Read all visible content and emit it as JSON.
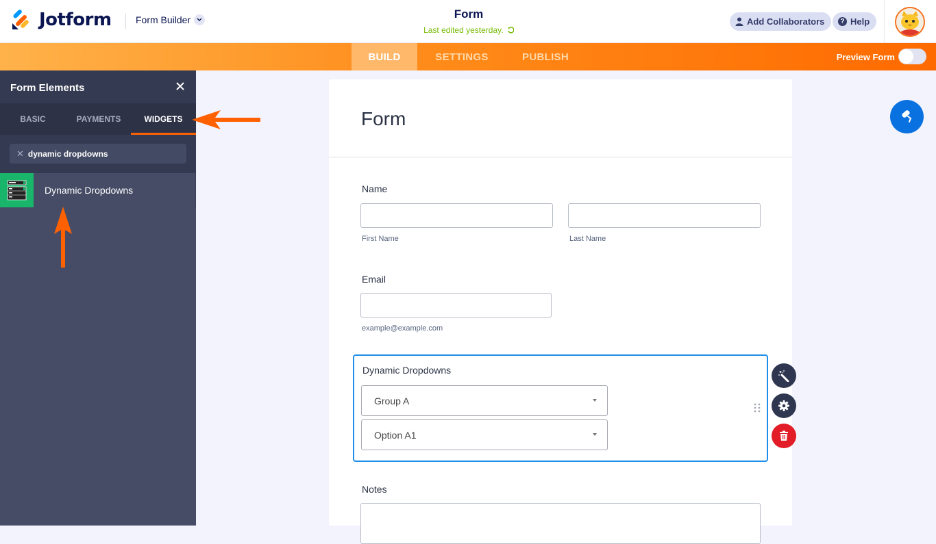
{
  "header": {
    "brand": "Jotform",
    "product_menu": "Form Builder",
    "form_title": "Form",
    "last_edited": "Last edited yesterday.",
    "add_collaborators": "Add Collaborators",
    "help": "Help"
  },
  "nav": {
    "tabs": [
      {
        "label": "BUILD",
        "active": true
      },
      {
        "label": "SETTINGS",
        "active": false
      },
      {
        "label": "PUBLISH",
        "active": false
      }
    ],
    "preview_label": "Preview Form",
    "preview_on": false
  },
  "sidebar": {
    "title": "Form Elements",
    "tabs": [
      {
        "label": "BASIC",
        "active": false
      },
      {
        "label": "PAYMENTS",
        "active": false
      },
      {
        "label": "WIDGETS",
        "active": true
      }
    ],
    "search_value": "dynamic dropdowns",
    "results": [
      {
        "label": "Dynamic Dropdowns",
        "icon": "dynamic-dropdowns-widget-icon"
      }
    ]
  },
  "form": {
    "title": "Form",
    "fields": {
      "name": {
        "label": "Name",
        "first_sublabel": "First Name",
        "last_sublabel": "Last Name",
        "first_value": "",
        "last_value": ""
      },
      "email": {
        "label": "Email",
        "sublabel": "example@example.com",
        "value": ""
      },
      "dynamic_dropdowns": {
        "label": "Dynamic Dropdowns",
        "selects": [
          "Group A",
          "Option A1"
        ]
      },
      "notes": {
        "label": "Notes",
        "value": ""
      }
    }
  },
  "colors": {
    "brand_orange": "#ff6100",
    "selection_blue": "#1f8ee8",
    "delete_red": "#e21d27",
    "edited_green": "#78bb07",
    "fab_blue": "#0a72e0"
  }
}
